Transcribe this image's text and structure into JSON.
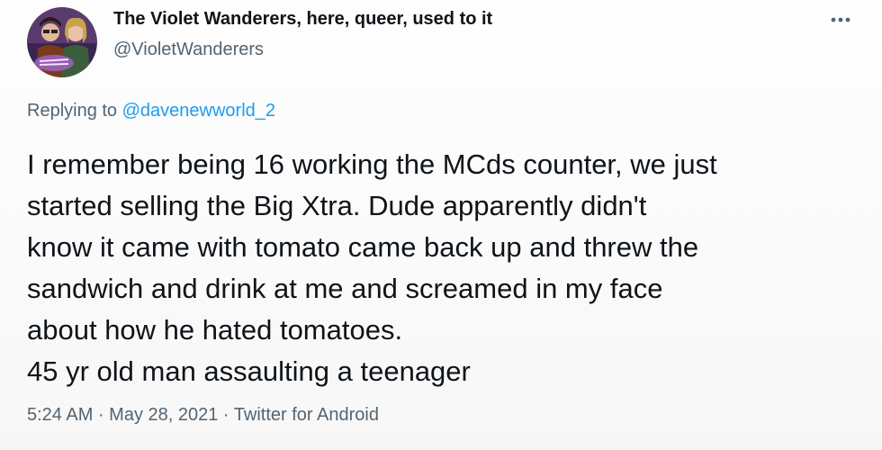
{
  "author": {
    "display_name": "The Violet Wanderers, here, queer, used to it",
    "handle": "@VioletWanderers",
    "avatar_icon": "avatar-image"
  },
  "reply": {
    "prefix": "Replying to ",
    "mention": "@davenewworld_2"
  },
  "tweet": {
    "text": "I remember being 16 working the MCds counter, we just\nstarted selling the Big Xtra. Dude apparently didn't\nknow it came with tomato came back up and threw the\nsandwich and drink at me and screamed in my face\nabout how he hated tomatoes.\n45 yr old man assaulting a teenager"
  },
  "meta": {
    "time": "5:24 AM",
    "sep1": " · ",
    "date": "May 28, 2021",
    "sep2": " · ",
    "source": "Twitter for Android"
  },
  "colors": {
    "link": "#1d9bf0",
    "secondary_text": "#536471",
    "primary_text": "#0f1419"
  },
  "icons": {
    "more": "more-options-icon"
  }
}
